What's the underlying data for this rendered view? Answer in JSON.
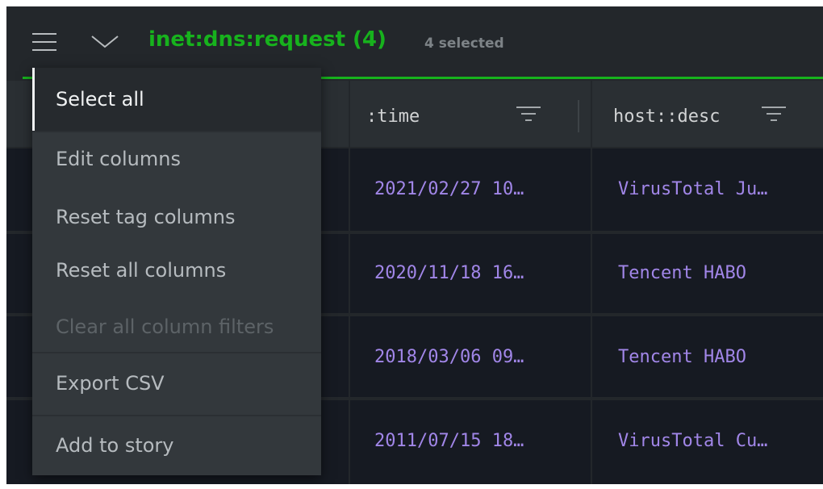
{
  "header": {
    "title": "inet:dns:request (4)",
    "subtitle": "4 selected",
    "accent_color": "#17b21d",
    "menu_icon": "hamburger-icon",
    "chevron_icon": "chevron-down-icon"
  },
  "table": {
    "columns": [
      {
        "label": ":time",
        "filter_icon": "filter-icon"
      },
      {
        "label": "host::desc",
        "filter_icon": "filter-icon"
      }
    ],
    "rows": [
      {
        "time": "2021/02/27 10…",
        "host_desc": "VirusTotal Ju…"
      },
      {
        "time": "2020/11/18 16…",
        "host_desc": "Tencent HABO"
      },
      {
        "time": "2018/03/06 09…",
        "host_desc": "Tencent HABO"
      },
      {
        "time": "2011/07/15 18…",
        "host_desc": "VirusTotal Cu…"
      }
    ]
  },
  "menu": {
    "items": [
      {
        "label": "Select all",
        "state": "active"
      },
      {
        "label": "Edit columns",
        "state": "normal"
      },
      {
        "label": "Reset tag columns",
        "state": "normal"
      },
      {
        "label": "Reset all columns",
        "state": "normal"
      },
      {
        "label": "Clear all column filters",
        "state": "disabled"
      },
      {
        "label": "Export CSV",
        "state": "normal"
      },
      {
        "label": "Add to story",
        "state": "normal"
      }
    ]
  }
}
